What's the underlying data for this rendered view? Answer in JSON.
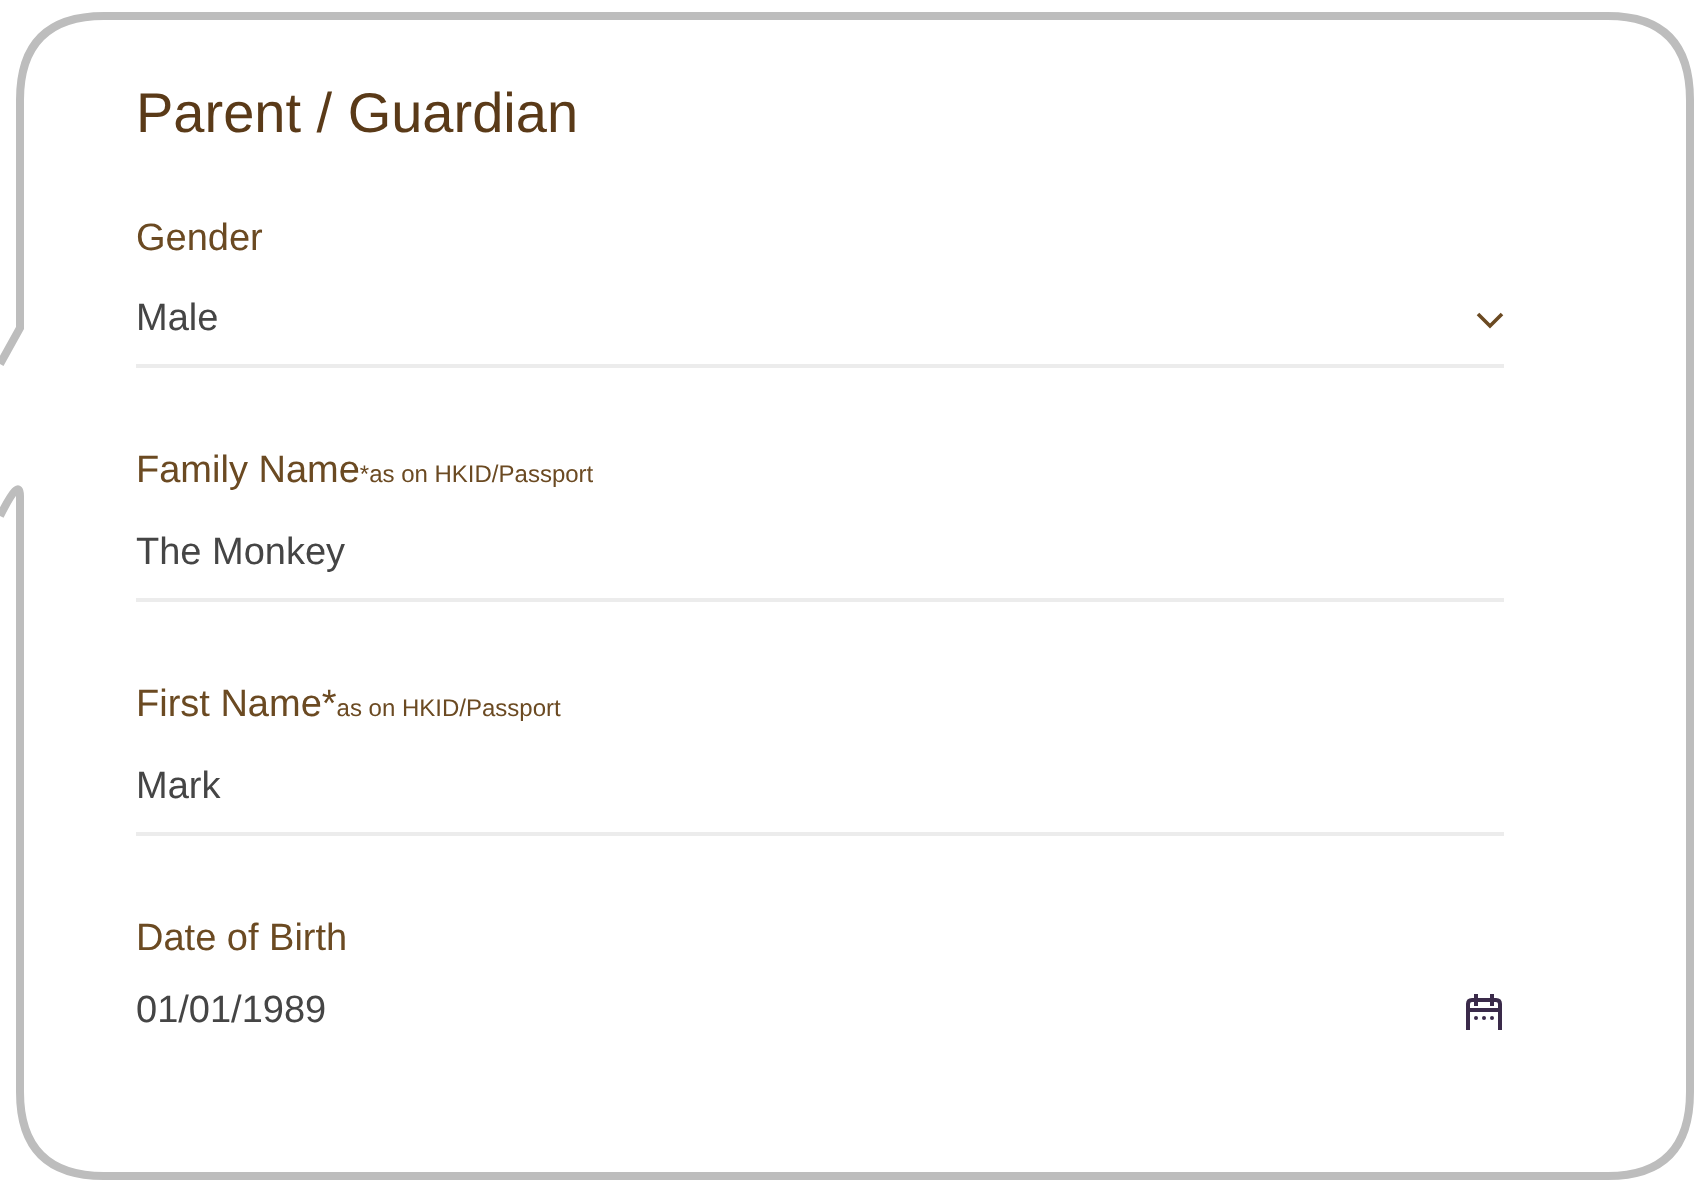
{
  "title": "Parent / Guardian",
  "fields": [
    {
      "kind": "select",
      "label": "Gender",
      "value": "Male"
    },
    {
      "kind": "text",
      "label": "Family Name ",
      "note": "*as on HKID/Passport",
      "value": "The Monkey"
    },
    {
      "kind": "text",
      "label": "First Name*",
      "note": " as on HKID/Passport",
      "value": "Mark"
    },
    {
      "kind": "date",
      "label": "Date of Birth",
      "value": "01/01/1989"
    }
  ]
}
